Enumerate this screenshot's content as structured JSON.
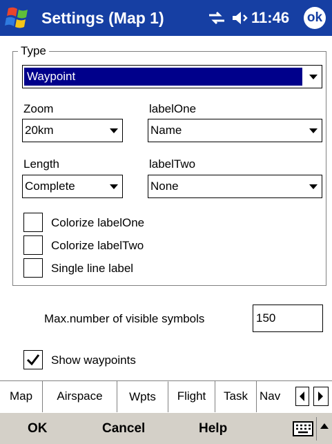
{
  "titlebar": {
    "title": "Settings (Map 1)",
    "time": "11:46",
    "ok_label": "ok",
    "start_icon": "windows-flag-icon",
    "connectivity_icon": "connectivity-icon",
    "volume_icon": "speaker-icon"
  },
  "type_group": {
    "legend": "Type",
    "type_value": "Waypoint"
  },
  "fields": {
    "zoom_label": "Zoom",
    "zoom_value": "20km",
    "label_one_label": "labelOne",
    "label_one_value": "Name",
    "length_label": "Length",
    "length_value": "Complete",
    "label_two_label": "labelTwo",
    "label_two_value": "None"
  },
  "checkboxes": {
    "colorize_one": {
      "label": "Colorize labelOne",
      "checked": false
    },
    "colorize_two": {
      "label": "Colorize labelTwo",
      "checked": false
    },
    "single_line": {
      "label": "Single line label",
      "checked": false
    }
  },
  "symbols": {
    "label": "Max.number of visible symbols",
    "value": "150"
  },
  "show_waypoints": {
    "label": "Show waypoints",
    "checked": true
  },
  "tabs": [
    {
      "label": "Map",
      "active": false
    },
    {
      "label": "Airspace",
      "active": false
    },
    {
      "label": "Wpts",
      "active": true
    },
    {
      "label": "Flight",
      "active": false
    },
    {
      "label": "Task",
      "active": false
    },
    {
      "label": "Nav",
      "active": false
    }
  ],
  "commandbar": {
    "ok_label": "OK",
    "cancel_label": "Cancel",
    "help_label": "Help"
  },
  "colors": {
    "titlebar_bg": "#163fa3",
    "selection_bg": "#00008b",
    "commandbar_bg": "#d4d0c8"
  }
}
